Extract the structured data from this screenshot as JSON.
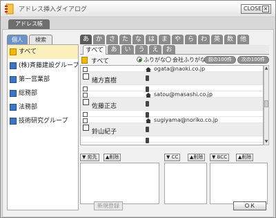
{
  "window": {
    "title": "アドレス挿入ダイアログ",
    "close_label": "CLOSE",
    "close_x": "×"
  },
  "main_tab": "アドレス帳",
  "left_tabs": [
    "個人",
    "検索"
  ],
  "groups": [
    {
      "label": "すべて",
      "selected": true
    },
    {
      "label": "(株)斉藤建設グループ",
      "selected": false
    },
    {
      "label": "第一営業部",
      "selected": false
    },
    {
      "label": "総務部",
      "selected": false
    },
    {
      "label": "法務部",
      "selected": false
    },
    {
      "label": "技術研究グループ",
      "selected": false
    }
  ],
  "kana_tabs": [
    "あ",
    "か",
    "さ",
    "た",
    "な",
    "は",
    "ま",
    "や",
    "ら",
    "わ",
    "英",
    "数",
    "他"
  ],
  "sub_tabs": [
    "すべて",
    "あ",
    "い",
    "う",
    "え",
    "お"
  ],
  "filter": {
    "label": "すべて",
    "radio_furigana": "ふりがな",
    "radio_company": "会社ふりがな",
    "prev": "前の100件",
    "next": "次の100件"
  },
  "contacts": [
    {
      "name": "緒方直樹",
      "email": "ogata@naoki.co.jp"
    },
    {
      "name": "佐藤正志",
      "email": "satou@masashi.co.jp"
    },
    {
      "name": "鈴山紀子",
      "email": "sugiyama@noriko.co.jp"
    }
  ],
  "recipients": [
    {
      "add": "宛先",
      "remove": "削除"
    },
    {
      "add": "CC",
      "remove": "削除"
    },
    {
      "add": "BCC",
      "remove": "削除"
    }
  ],
  "buttons": {
    "new": "新規登録",
    "ok": "ＯＫ"
  },
  "colors": {
    "selected_group": "#fbf0bc",
    "active_left_tab": "#6a93c9",
    "kana_tab": "#8a8a8a"
  }
}
